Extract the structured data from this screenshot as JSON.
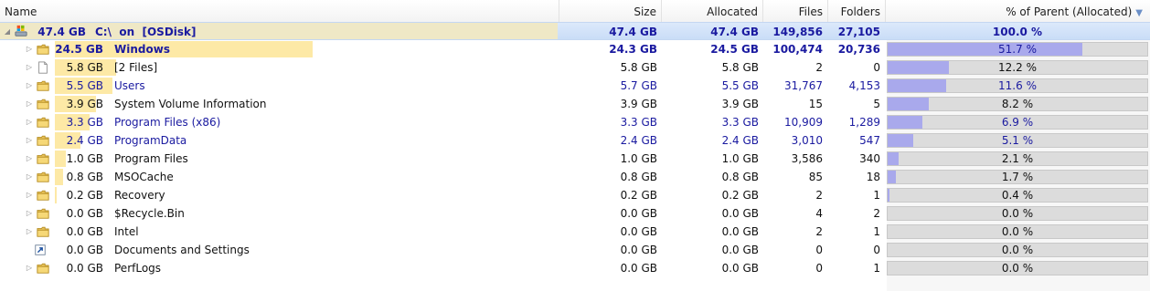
{
  "columns": {
    "name": "Name",
    "size": "Size",
    "allocated": "Allocated",
    "files": "Files",
    "folders": "Folders",
    "pct": "% of Parent (Allocated)"
  },
  "root": {
    "size_label": "47.4 GB",
    "name": "C:\\  on  [OSDisk]",
    "size": "47.4 GB",
    "allocated": "47.4 GB",
    "files": "149,856",
    "folders": "27,105",
    "pct": "100.0 %"
  },
  "rows": [
    {
      "size_label": "24.5 GB",
      "name": "Windows",
      "size": "24.3 GB",
      "allocated": "24.5 GB",
      "files": "100,474",
      "folders": "20,736",
      "pct": "51.7 %",
      "pct_value": 51.7,
      "bar_fraction": 1.0,
      "icon": "folder-icon",
      "expandable": true,
      "blue": true,
      "bold": true
    },
    {
      "size_label": "5.8 GB",
      "name": "[2 Files]",
      "size": "5.8 GB",
      "allocated": "5.8 GB",
      "files": "2",
      "folders": "0",
      "pct": "12.2 %",
      "pct_value": 12.2,
      "bar_fraction": 0.237,
      "icon": "file-icon",
      "expandable": true,
      "blue": false,
      "bold": false
    },
    {
      "size_label": "5.5 GB",
      "name": "Users",
      "size": "5.7 GB",
      "allocated": "5.5 GB",
      "files": "31,767",
      "folders": "4,153",
      "pct": "11.6 %",
      "pct_value": 11.6,
      "bar_fraction": 0.224,
      "icon": "folder-icon",
      "expandable": true,
      "blue": true,
      "bold": false
    },
    {
      "size_label": "3.9 GB",
      "name": "System Volume Information",
      "size": "3.9 GB",
      "allocated": "3.9 GB",
      "files": "15",
      "folders": "5",
      "pct": "8.2 %",
      "pct_value": 8.2,
      "bar_fraction": 0.159,
      "icon": "folder-icon",
      "expandable": true,
      "blue": false,
      "bold": false
    },
    {
      "size_label": "3.3 GB",
      "name": "Program Files (x86)",
      "size": "3.3 GB",
      "allocated": "3.3 GB",
      "files": "10,909",
      "folders": "1,289",
      "pct": "6.9 %",
      "pct_value": 6.9,
      "bar_fraction": 0.135,
      "icon": "folder-icon",
      "expandable": true,
      "blue": true,
      "bold": false
    },
    {
      "size_label": "2.4 GB",
      "name": "ProgramData",
      "size": "2.4 GB",
      "allocated": "2.4 GB",
      "files": "3,010",
      "folders": "547",
      "pct": "5.1 %",
      "pct_value": 5.1,
      "bar_fraction": 0.098,
      "icon": "folder-icon",
      "expandable": true,
      "blue": true,
      "bold": false
    },
    {
      "size_label": "1.0 GB",
      "name": "Program Files",
      "size": "1.0 GB",
      "allocated": "1.0 GB",
      "files": "3,586",
      "folders": "340",
      "pct": "2.1 %",
      "pct_value": 2.1,
      "bar_fraction": 0.041,
      "icon": "folder-icon",
      "expandable": true,
      "blue": false,
      "bold": false
    },
    {
      "size_label": "0.8 GB",
      "name": "MSOCache",
      "size": "0.8 GB",
      "allocated": "0.8 GB",
      "files": "85",
      "folders": "18",
      "pct": "1.7 %",
      "pct_value": 1.7,
      "bar_fraction": 0.033,
      "icon": "folder-icon",
      "expandable": true,
      "blue": false,
      "bold": false
    },
    {
      "size_label": "0.2 GB",
      "name": "Recovery",
      "size": "0.2 GB",
      "allocated": "0.2 GB",
      "files": "2",
      "folders": "1",
      "pct": "0.4 %",
      "pct_value": 0.4,
      "bar_fraction": 0.008,
      "icon": "folder-icon",
      "expandable": true,
      "blue": false,
      "bold": false
    },
    {
      "size_label": "0.0 GB",
      "name": "$Recycle.Bin",
      "size": "0.0 GB",
      "allocated": "0.0 GB",
      "files": "4",
      "folders": "2",
      "pct": "0.0 %",
      "pct_value": 0.0,
      "bar_fraction": 0,
      "icon": "folder-icon",
      "expandable": true,
      "blue": false,
      "bold": false
    },
    {
      "size_label": "0.0 GB",
      "name": "Intel",
      "size": "0.0 GB",
      "allocated": "0.0 GB",
      "files": "2",
      "folders": "1",
      "pct": "0.0 %",
      "pct_value": 0.0,
      "bar_fraction": 0,
      "icon": "folder-icon",
      "expandable": true,
      "blue": false,
      "bold": false
    },
    {
      "size_label": "0.0 GB",
      "name": "Documents and Settings",
      "size": "0.0 GB",
      "allocated": "0.0 GB",
      "files": "0",
      "folders": "0",
      "pct": "0.0 %",
      "pct_value": 0.0,
      "bar_fraction": 0,
      "icon": "shortcut-icon",
      "expandable": false,
      "blue": false,
      "bold": false
    },
    {
      "size_label": "0.0 GB",
      "name": "PerfLogs",
      "size": "0.0 GB",
      "allocated": "0.0 GB",
      "files": "0",
      "folders": "1",
      "pct": "0.0 %",
      "pct_value": 0.0,
      "bar_fraction": 0,
      "icon": "folder-icon",
      "expandable": true,
      "blue": false,
      "bold": false
    }
  ],
  "colors": {
    "name_blue": "#1a1aa0",
    "size_bar": "#fde9a6",
    "pct_fill": "#a9a9ec",
    "selection": "#c9ddf7"
  }
}
